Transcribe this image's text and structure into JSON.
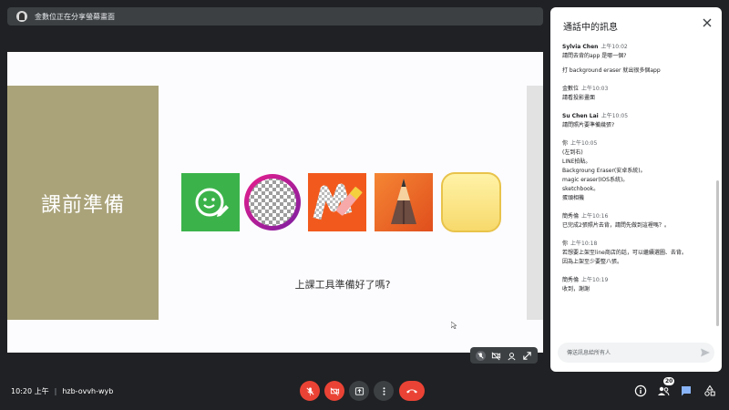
{
  "presenter": {
    "text": "金數位正在分享螢幕畫面"
  },
  "slide": {
    "title": "課前準備",
    "question": "上課工具準備好了嗎?",
    "icons": [
      "line-camera-icon",
      "background-eraser-icon",
      "magic-eraser-icon",
      "sketchbook-icon",
      "notes-icon"
    ]
  },
  "chat": {
    "title": "通話中的訊息",
    "input_placeholder": "傳送訊息給所有人",
    "messages": [
      {
        "sender": "Sylvia Chen",
        "time": "上午10:02",
        "lines": [
          "請問去背的app 是哪一個?",
          "打 background eraser 就出很多個app"
        ]
      },
      {
        "sender": "金數位",
        "time": "上午10:03",
        "lines": [
          "請看投影畫面"
        ]
      },
      {
        "sender": "Su Chen Lai",
        "time": "上午10:05",
        "lines": [
          "請問照片要準備幾張?"
        ]
      },
      {
        "sender": "你",
        "time": "上午10:05",
        "lines": [
          "(左到右)",
          "LINE拍貼。",
          "Backgroung Eraser(安卓系統)。",
          "magic eraser(IOS系統)。",
          "sketchbook。",
          "蛋頭相機"
        ]
      },
      {
        "sender": "簡秀倫",
        "time": "上午10:16",
        "lines": [
          "已完成2張照片去背，請問先做到這裡嗎？。"
        ]
      },
      {
        "sender": "你",
        "time": "上午10:18",
        "lines": [
          "若想要上架至line商店的話，可以繼續選圖、去背。",
          "因為上架至少要整八張。"
        ]
      },
      {
        "sender": "簡秀倫",
        "time": "上午10:19",
        "lines": [
          "收到，謝謝"
        ]
      }
    ]
  },
  "meeting": {
    "time": "10:20 上午",
    "separator": "|",
    "code": "hzb-ovvh-wyb",
    "participants_count": "20"
  },
  "colors": {
    "end_call": "#ea4335",
    "chat_active": "#8ab4f8",
    "slide_block": "#aaa37a"
  }
}
